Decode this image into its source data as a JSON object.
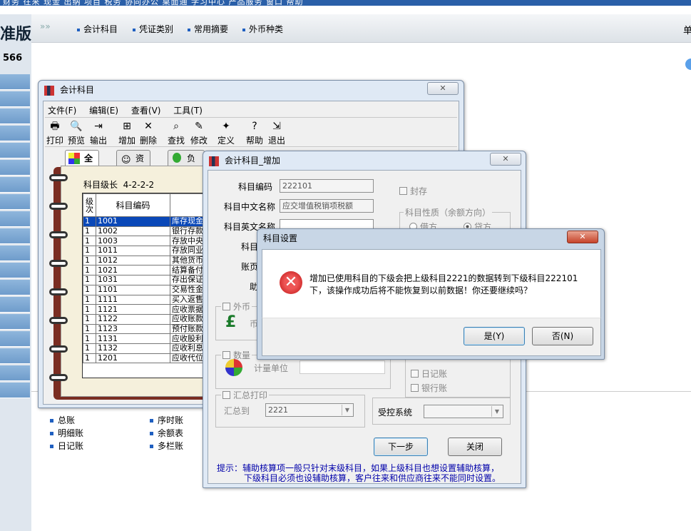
{
  "top_menu": "财务  往来  现金  出纳  项目  税务  协同办公  桌面通  学习中心  产品服务  窗口  帮助",
  "left": {
    "brand": "准版",
    "number": "566"
  },
  "nav": {
    "items": [
      "会计科目",
      "凭证类别",
      "常用摘要",
      "外币种类"
    ],
    "right_text": "单"
  },
  "bottom_links": [
    {
      "label": "总账"
    },
    {
      "label": "明细账"
    },
    {
      "label": "日记账"
    },
    {
      "label": "序时账"
    },
    {
      "label": "余额表"
    },
    {
      "label": "多栏账"
    }
  ],
  "accounts_window": {
    "title": "会计科目",
    "menu": [
      "文件(F)",
      "编辑(E)",
      "查看(V)",
      "工具(T)"
    ],
    "toolbar": [
      "打印",
      "预览",
      "输出",
      "增加",
      "删除",
      "查找",
      "修改",
      "定义",
      "帮助",
      "退出"
    ],
    "tabs": [
      "全部",
      "资产",
      "负"
    ],
    "level_label": "科目级长",
    "level_value": "4-2-2-2",
    "columns": [
      "级次",
      "科目编码",
      ""
    ],
    "rows": [
      {
        "level": "1",
        "code": "1001",
        "name": "库存现金"
      },
      {
        "level": "1",
        "code": "1002",
        "name": "银行存款"
      },
      {
        "level": "1",
        "code": "1003",
        "name": "存放中央"
      },
      {
        "level": "1",
        "code": "1011",
        "name": "存放同业"
      },
      {
        "level": "1",
        "code": "1012",
        "name": "其他货币"
      },
      {
        "level": "1",
        "code": "1021",
        "name": "结算备付"
      },
      {
        "level": "1",
        "code": "1031",
        "name": "存出保证"
      },
      {
        "level": "1",
        "code": "1101",
        "name": "交易性金"
      },
      {
        "level": "1",
        "code": "1111",
        "name": "买入返售"
      },
      {
        "level": "1",
        "code": "1121",
        "name": "应收票据"
      },
      {
        "level": "1",
        "code": "1122",
        "name": "应收账款"
      },
      {
        "level": "1",
        "code": "1123",
        "name": "预付账款"
      },
      {
        "level": "1",
        "code": "1131",
        "name": "应收股利"
      },
      {
        "level": "1",
        "code": "1132",
        "name": "应收利息"
      },
      {
        "level": "1",
        "code": "1201",
        "name": "应收代位"
      }
    ]
  },
  "add_window": {
    "title": "会计科目_增加",
    "code_label": "科目编码",
    "code_value": "222101",
    "cn_name_label": "科目中文名称",
    "cn_name_value": "应交增值税销项税额",
    "en_name_label": "科目英文名称",
    "type_label": "科目",
    "page_label": "账页",
    "help_label": "助",
    "seal_label": "封存",
    "nature_group": "科目性质（余额方向）",
    "debit": "借方",
    "credit": "贷方",
    "foreign_label": "外币",
    "currency_label": "币",
    "quantity_label": "数量",
    "unit_label": "计量单位",
    "journal_label": "日记账",
    "bank_label": "银行账",
    "summary_print": "汇总打印",
    "summary_to": "汇总到",
    "summary_to_value": "2221",
    "controlled_label": "受控系统",
    "next_button": "下一步",
    "close_button": "关闭",
    "hint_line1": "提示：辅助核算项一般只针对末级科目，如果上级科目也想设置辅助核算，",
    "hint_line2": "下级科目必须也设辅助核算，客户往来和供应商往来不能同时设置。"
  },
  "confirm_dialog": {
    "title": "科目设置",
    "message_line1": "增加已使用科目的下级会把上级科目2221的数据转到下级科目222101",
    "message_line2": "下，该操作成功后将不能恢复到以前数据！你还要继续吗？",
    "yes_button": "是(Y)",
    "no_button": "否(N)",
    "icon": "error-icon"
  }
}
